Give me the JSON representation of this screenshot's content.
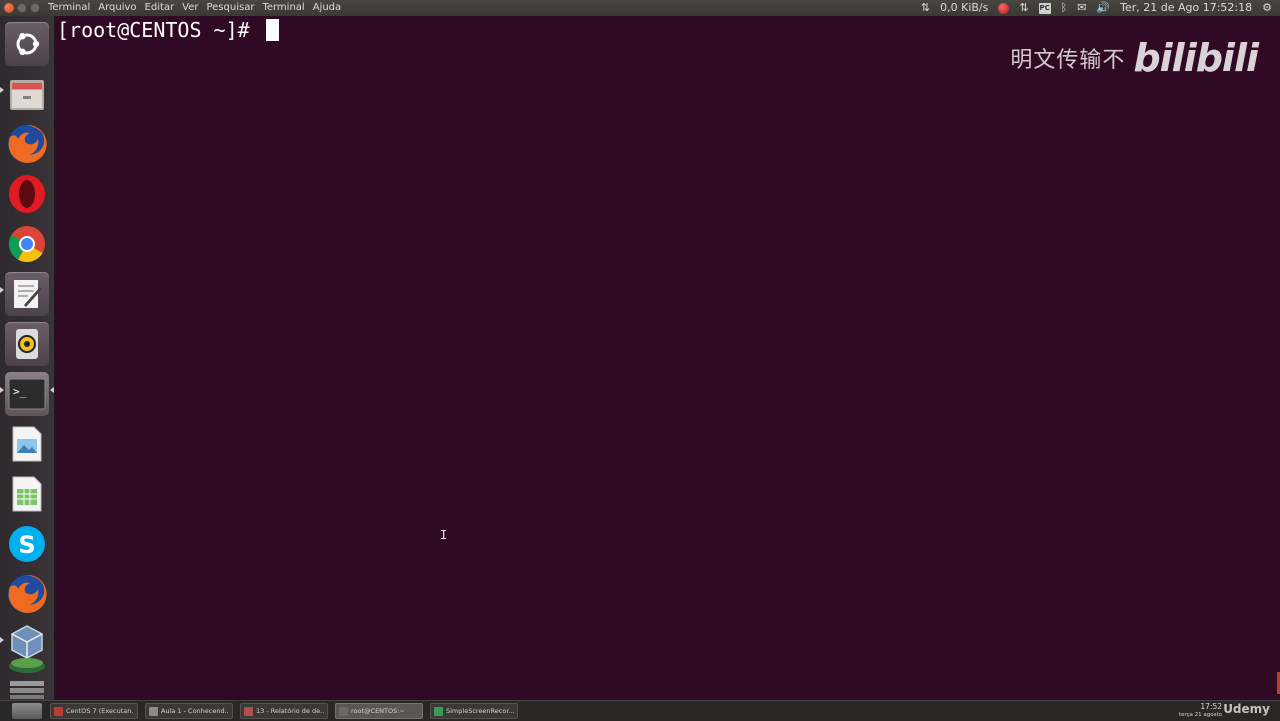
{
  "top_panel": {
    "menu": [
      "Terminal",
      "Arquivo",
      "Editar",
      "Ver",
      "Pesquisar",
      "Terminal",
      "Ajuda"
    ],
    "network_speed": "0,0 KiB/s",
    "pc_badge": "PC",
    "datetime": "Ter, 21 de Ago 17:52:18"
  },
  "launcher": {
    "items": [
      {
        "name": "ubuntu-dash-icon"
      },
      {
        "name": "file-manager-icon"
      },
      {
        "name": "firefox-icon"
      },
      {
        "name": "opera-icon"
      },
      {
        "name": "chrome-icon"
      },
      {
        "name": "text-editor-icon"
      },
      {
        "name": "rhythmbox-icon"
      },
      {
        "name": "terminal-icon"
      },
      {
        "name": "image-viewer-icon"
      },
      {
        "name": "spreadsheet-icon"
      },
      {
        "name": "skype-icon"
      },
      {
        "name": "firefox-icon-2"
      },
      {
        "name": "virtualbox-icon"
      },
      {
        "name": "workspace-icon"
      },
      {
        "name": "trash-icon"
      }
    ]
  },
  "terminal": {
    "prompt": "[root@CENTOS ~]# "
  },
  "watermark": {
    "text": "明文传输不",
    "logo": "bilibili"
  },
  "taskbar": {
    "tasks": [
      {
        "label": "CentOS 7 (Executan...",
        "color": "#c0392b"
      },
      {
        "label": "Aula 1 - Conhecend...",
        "color": "#8a8a8a"
      },
      {
        "label": "13 - Relatório de de...",
        "color": "#b05050"
      },
      {
        "label": "root@CENTOS:~",
        "color": "#6a6a6a"
      },
      {
        "label": "SimpleScreenRecor...",
        "color": "#3a9a5a"
      }
    ],
    "time": "17:52",
    "date": "terça 21 agosto",
    "brand": "Udemy"
  },
  "colors": {
    "terminal_bg": "#300a24",
    "panel_bg": "#3c3b37"
  }
}
